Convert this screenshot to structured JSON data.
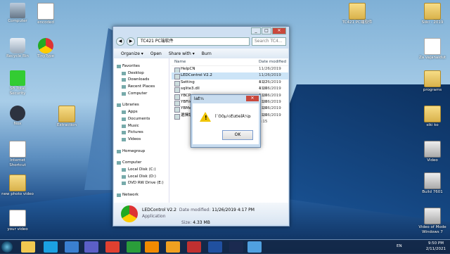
{
  "desktop_icons_left": [
    {
      "label": "Computer",
      "kind": "pc"
    },
    {
      "label": "encoded",
      "kind": "doc"
    },
    {
      "label": "Recycle Bin",
      "kind": "trash"
    },
    {
      "label": "TinyType",
      "kind": "chrome"
    },
    {
      "label": "SB Total Security",
      "kind": "repair"
    },
    {
      "label": "Nox",
      "kind": "nox"
    },
    {
      "label": "Extraction",
      "kind": "folder"
    },
    {
      "label": "Internet Shortcut",
      "kind": "doc"
    },
    {
      "label": "new photo video",
      "kind": "folder"
    },
    {
      "label": "your video",
      "kind": "doc"
    }
  ],
  "desktop_icons_right": [
    {
      "label": "TC421 PC端软件",
      "kind": "folder"
    },
    {
      "label": "Siiki - 2019",
      "kind": "folder"
    },
    {
      "label": "Za vajanaidut",
      "kind": "pdf"
    },
    {
      "label": "programs",
      "kind": "folder"
    },
    {
      "label": "siki ko",
      "kind": "folder"
    },
    {
      "label": "Video",
      "kind": "video"
    },
    {
      "label": "Build 7601",
      "kind": "video"
    },
    {
      "label": "Video of Mode Windows 7",
      "kind": "video"
    }
  ],
  "explorer": {
    "path": "TC421 PC端软件",
    "search": "Search TC4...",
    "toolbar": [
      "Organize ▾",
      "Open",
      "Share with ▾",
      "Burn"
    ],
    "nav": {
      "favorites_header": "Favorites",
      "favorites": [
        "Desktop",
        "Downloads",
        "Recent Places",
        "Computer"
      ],
      "libraries_header": "Libraries",
      "libraries": [
        "Apps",
        "Documents",
        "Music",
        "Pictures",
        "Videos"
      ],
      "homegroup": "Homegroup",
      "computer_header": "Computer",
      "drives": [
        "Local Disk (C:)",
        "Local Disk (D:)",
        "DVD RW Drive (E:)"
      ],
      "network": "Network"
    },
    "columns": {
      "name": "Name",
      "date": "Date modified"
    },
    "files": [
      {
        "name": "HelpCN",
        "date": "11/26/2019 4:15"
      },
      {
        "name": "LEDControl V2.2",
        "date": "11/26/2019 4:17"
      },
      {
        "name": "Setting",
        "date": "11/26/2019 4:16"
      },
      {
        "name": "sqlite3.dll",
        "date": "11/26/2019 4:16"
      },
      {
        "name": "YBCP...",
        "date": "11/26/2019 4:16"
      },
      {
        "name": "YBFile...",
        "date": "11/26/2019 4:16"
      },
      {
        "name": "YBMe...",
        "date": "11/26/2019 4:16"
      },
      {
        "name": "選擇語...",
        "date": "11/26/2019 4:15"
      }
    ],
    "details": {
      "name": "LEDControl V2.2",
      "modified_label": "Date modified:",
      "modified": "11/26/2019 4:17 PM",
      "type": "Application",
      "size_label": "Size:",
      "size": "4.33 MB"
    }
  },
  "dialog": {
    "title": "ÌáÊ¾",
    "message": "Î´ÕÒµ½ËùÐèÎÄ¼þ",
    "ok": "OK"
  },
  "tray": {
    "lang": "EN",
    "time": "9:50 PM",
    "date": "2/11/2021"
  }
}
